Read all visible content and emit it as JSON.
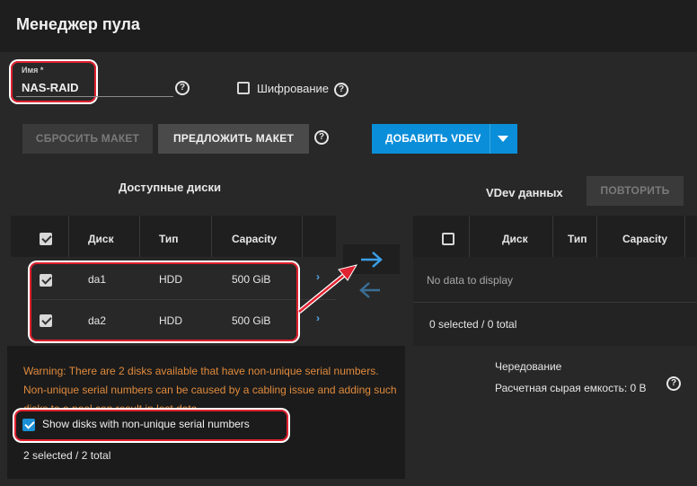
{
  "header": {
    "title": "Менеджер пула"
  },
  "name_field": {
    "label": "Имя *",
    "value": "NAS-RAID"
  },
  "encryption": {
    "label": "Шифрование",
    "checked": false
  },
  "buttons": {
    "reset_layout": "СБРОСИТЬ МАКЕТ",
    "suggest_layout": "ПРЕДЛОЖИТЬ МАКЕТ",
    "add_vdev": "ДОБАВИТЬ VDEV",
    "repeat": "ПОВТОРИТЬ"
  },
  "available_disks": {
    "title": "Доступные диски",
    "columns": [
      "Диск",
      "Тип",
      "Capacity"
    ],
    "rows": [
      {
        "disk": "da1",
        "type": "HDD",
        "capacity": "500 GiB",
        "checked": true
      },
      {
        "disk": "da2",
        "type": "HDD",
        "capacity": "500 GiB",
        "checked": true
      }
    ],
    "warning": "Warning: There are 2 disks available that have non-unique serial numbers. Non-unique serial numbers can be caused by a cabling issue and adding such disks to a pool can result in lost data.",
    "show_nonunique_label": "Show disks with non-unique serial numbers",
    "show_nonunique_checked": true,
    "selection_count": "2 selected / 2 total"
  },
  "data_vdev": {
    "title": "VDev данных",
    "columns": [
      "Диск",
      "Тип",
      "Capacity"
    ],
    "empty_text": "No data to display",
    "selection_count": "0 selected / 0 total"
  },
  "summary": {
    "striping_label": "Чередование",
    "raw_capacity": "Расчетная сырая емкость: 0 B"
  },
  "colors": {
    "accent": "#0a8ed9",
    "warning": "#e08a3c",
    "highlight": "#e0212f"
  }
}
